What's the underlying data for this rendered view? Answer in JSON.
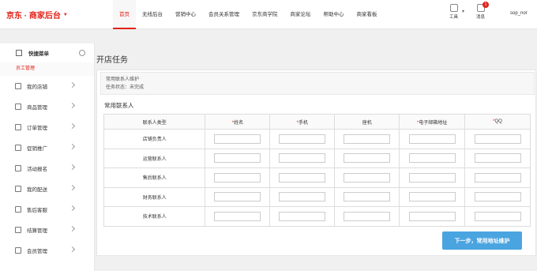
{
  "header": {
    "logo": "京东 · 商家后台",
    "nav": [
      "首页",
      "无线后台",
      "营销中心",
      "会员关系管理",
      "京东商学院",
      "商家论坛",
      "帮助中心",
      "商家看板"
    ],
    "active_index": 0,
    "tools_label": "工具",
    "messages_label": "消息",
    "message_count": "1",
    "username": "sop_nor"
  },
  "sidebar": {
    "quick_menu": "快捷菜单",
    "quick_sub": "员工管理",
    "items": [
      "我的店铺",
      "商品管理",
      "订单管理",
      "促销推广",
      "活动报名",
      "我的配送",
      "售后客服",
      "结算管理",
      "会员管理"
    ]
  },
  "main": {
    "page_title": "开店任务",
    "info_line1": "常用联系人维护",
    "info_line2": "任务状态：未完成",
    "section_title": "常用联系人",
    "columns": [
      "联系人类型",
      "姓名",
      "手机",
      "座机",
      "电子邮箱地址",
      "QQ"
    ],
    "required_mark": "*",
    "rows": [
      "店铺负责人",
      "运营联系人",
      "售后联系人",
      "财务联系人",
      "技术联系人"
    ],
    "next_button": "下一步，常用地址维护"
  }
}
